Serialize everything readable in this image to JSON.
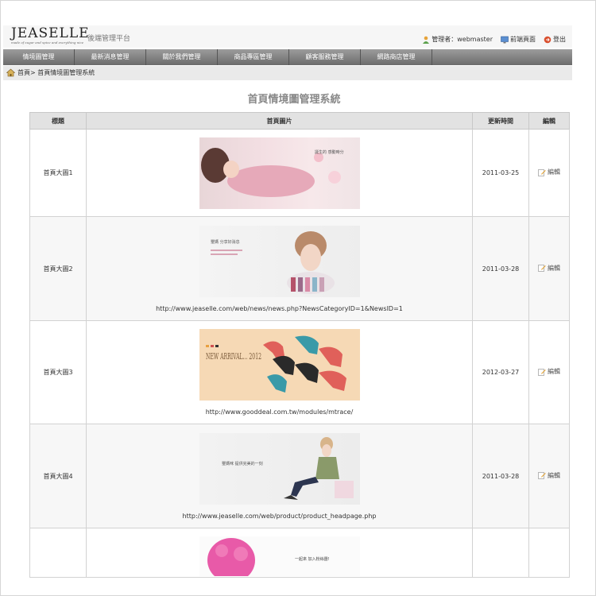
{
  "header": {
    "brand": "JEASELLE",
    "brand_tag": "made of sugar and spice and everything nice",
    "subtitle": "後端管理平台",
    "admin_label": "管理者：webmaster",
    "frontend_label": "前端頁面",
    "logout_label": "登出"
  },
  "nav": {
    "tabs": [
      "情境圖管理",
      "最新消息管理",
      "關於我們管理",
      "商品專區管理",
      "顧客服務管理",
      "網路商店管理"
    ]
  },
  "breadcrumb": {
    "home": "首頁",
    "separator": "> ",
    "current": "首頁情境圖管理系統"
  },
  "page_title": "首頁情境圖管理系統",
  "table": {
    "headers": [
      "標題",
      "首頁圖片",
      "更新時間",
      "編輯"
    ],
    "rows": [
      {
        "title": "首頁大圖1",
        "url": "",
        "date": "2011-03-25",
        "edit": "編輯",
        "img_text": "誕生的 感動時分",
        "img_theme": "pink"
      },
      {
        "title": "首頁大圖2",
        "url": "http://www.jeaselle.com/web/news/news.php?NewsCategoryID=1&NewsID=1",
        "date": "2011-03-28",
        "edit": "編輯",
        "img_text": "璽媽 分享好消息",
        "img_theme": "white"
      },
      {
        "title": "首頁大圖3",
        "url": "http://www.gooddeal.com.tw/modules/mtrace/",
        "date": "2012-03-27",
        "edit": "編輯",
        "img_text": "NEW ARRIVAL... 2012",
        "img_theme": "shoes"
      },
      {
        "title": "首頁大圖4",
        "url": "http://www.jeaselle.com/web/product/product_headpage.php",
        "date": "2011-03-28",
        "edit": "編輯",
        "img_text": "璽媽咪 提供完美的一刻",
        "img_theme": "grey"
      },
      {
        "title": "",
        "url": "",
        "date": "",
        "edit": "",
        "img_text": "一起來 加入粉絲團!",
        "img_theme": "fans"
      }
    ]
  },
  "colors": {
    "nav_top": "#9c9c9c",
    "nav_bottom": "#6c6c6c",
    "header_bg": "#e2e2e2",
    "title_color": "#888888"
  }
}
